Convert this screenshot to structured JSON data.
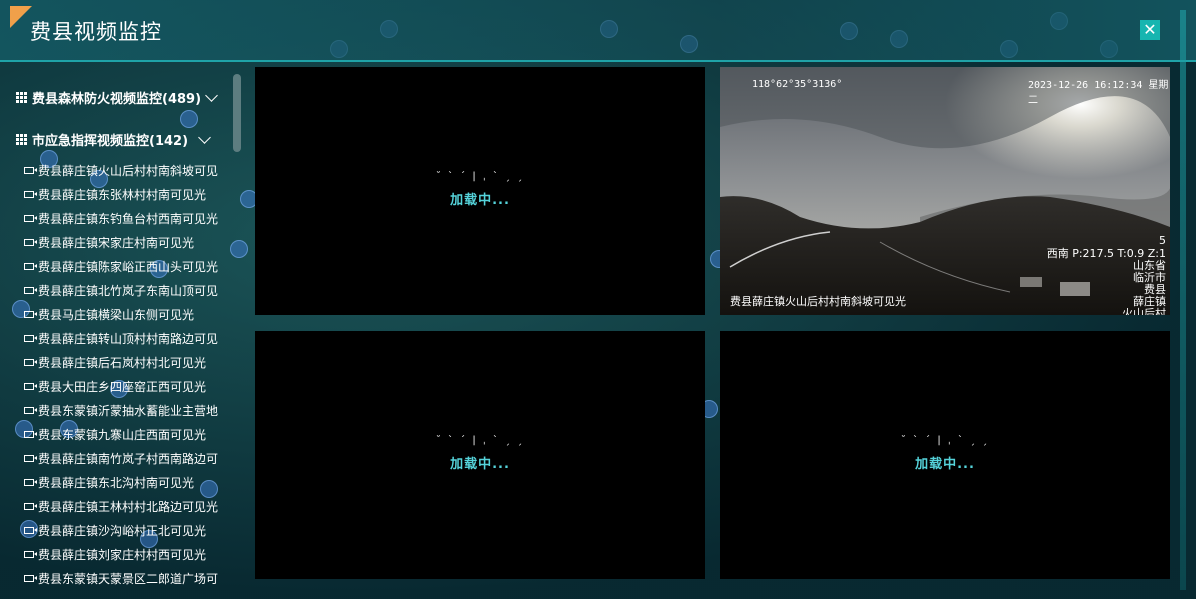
{
  "window": {
    "title": "费县视频监控",
    "close_glyph": "✕"
  },
  "sidebar": {
    "groups": [
      {
        "label": "费县森林防火视频监控(489)"
      },
      {
        "label": "市应急指挥视频监控(142)"
      }
    ],
    "items": [
      "费县薛庄镇火山后村村南斜坡可见",
      "费县薛庄镇东张林村村南可见光",
      "费县薛庄镇东钓鱼台村西南可见光",
      "费县薛庄镇宋家庄村南可见光",
      "费县薛庄镇陈家峪正西山头可见光",
      "费县薛庄镇北竹岚子东南山顶可见",
      "费县马庄镇横梁山东侧可见光",
      "费县薛庄镇转山顶村村南路边可见",
      "费县薛庄镇后石岚村村北可见光",
      "费县大田庄乡四座窑正西可见光",
      "费县东蒙镇沂蒙抽水蓄能业主营地",
      "费县东蒙镇九寨山庄西面可见光",
      "费县薛庄镇南竹岚子村西南路边可",
      "费县薛庄镇东北沟村南可见光",
      "费县薛庄镇王林村村北路边可见光",
      "费县薛庄镇沙沟峪村正北可见光",
      "费县薛庄镇刘家庄村村西可见光",
      "费县东蒙镇天蒙景区二郎道广场可"
    ]
  },
  "panes": {
    "loading_text": "加载中...",
    "loading_dots": "˘ ˋ ˊ | ˌ ˋ ˏ ˏ"
  },
  "camera": {
    "coords": "118°62°35°3136°",
    "datetime": "2023-12-26 16:12:34 星期二",
    "ptz": "西南  P:217.5 T:0.9 Z:1",
    "ptz_index": "5",
    "region_lines": [
      "山东省",
      "临沂市",
      "费县",
      "薛庄镇",
      "火山后村"
    ],
    "caption": "费县薛庄镇火山后村村南斜坡可见光"
  },
  "colors": {
    "accent": "#17b5b0",
    "loading": "#55d3da",
    "corner": "#f0a04a"
  }
}
